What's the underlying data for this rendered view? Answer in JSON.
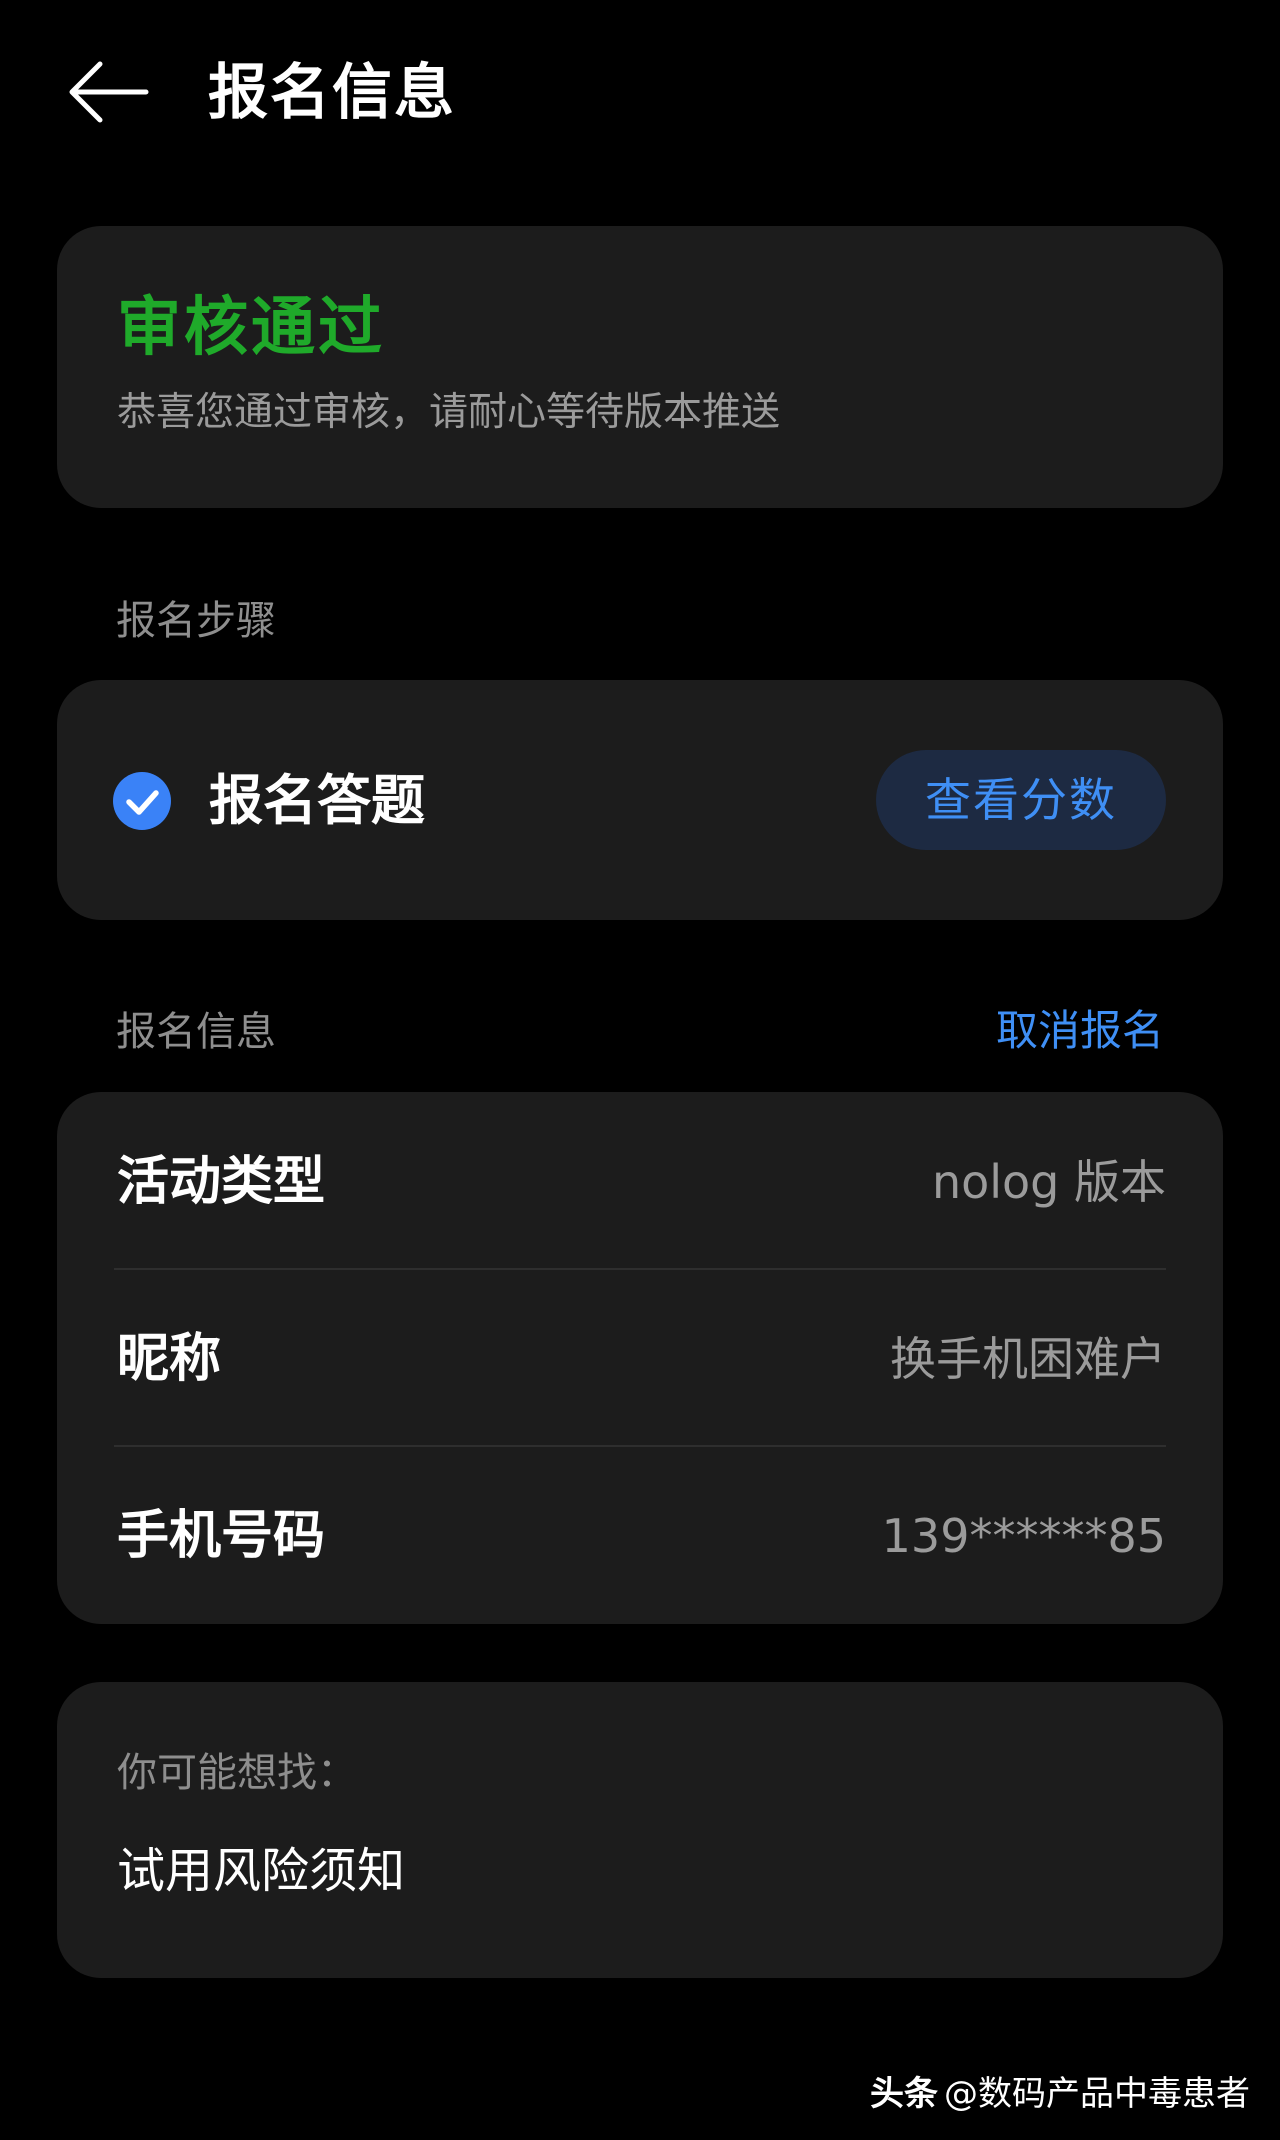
{
  "header": {
    "title": "报名信息",
    "back_icon": "arrow-left-icon"
  },
  "status": {
    "title": "审核通过",
    "description": "恭喜您通过审核，请耐心等待版本推送",
    "title_color": "#1faa2a"
  },
  "steps": {
    "section_label": "报名步骤",
    "items": [
      {
        "label": "报名答题",
        "completed": true,
        "icon": "check-circle-icon",
        "action_label": "查看分数"
      }
    ]
  },
  "info": {
    "section_label": "报名信息",
    "cancel_label": "取消报名",
    "rows": [
      {
        "key": "活动类型",
        "value": "nolog 版本"
      },
      {
        "key": "昵称",
        "value": "换手机困难户"
      },
      {
        "key": "手机号码",
        "value": "139******85"
      }
    ]
  },
  "suggest": {
    "label": "你可能想找：",
    "items": [
      "试用风险须知"
    ]
  },
  "watermark": {
    "brand": "头条",
    "text": "@数码产品中毒患者"
  },
  "colors": {
    "accent": "#3f8ff5",
    "success": "#1faa2a",
    "card": "#1c1c1c",
    "background": "#000000"
  }
}
